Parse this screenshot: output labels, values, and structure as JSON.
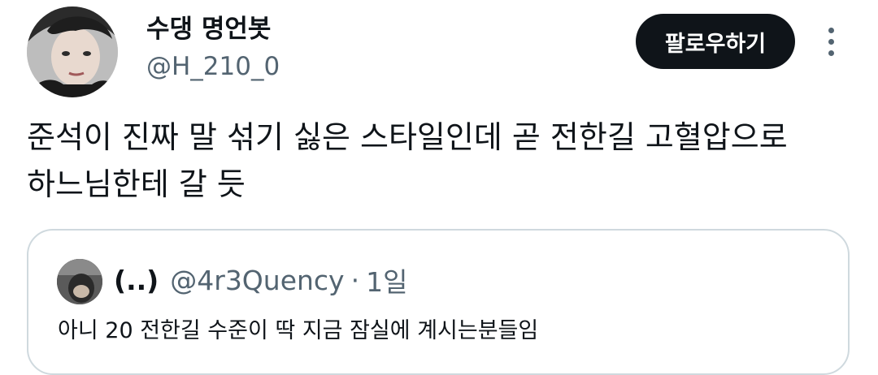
{
  "tweet": {
    "author": {
      "display_name": "수댕 명언봇",
      "handle": "@H_210_0",
      "avatar": "profile-photo"
    },
    "follow_label": "팔로우하기",
    "more_icon": "more-vertical-icon",
    "text_lines": [
      "준석이 진짜 말 섞기 싫은 스타일인데 곧 전한길 고혈압으로",
      "하느님한테 갈 듯"
    ],
    "quote": {
      "avatar": "profile-photo",
      "display_name": "(..)",
      "handle": "@4r3Quency",
      "separator": "·",
      "time": "1일",
      "text": "아니 20 전한길 수준이 딱 지금 잠실에 계시는분들임"
    }
  }
}
